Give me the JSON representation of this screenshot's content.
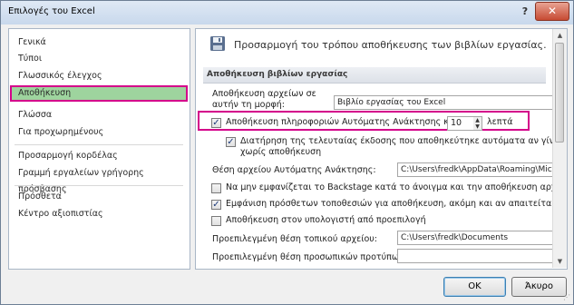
{
  "window": {
    "title": "Επιλογές του Excel",
    "help_glyph": "?",
    "close_glyph": "✕"
  },
  "sidebar": {
    "items": [
      {
        "label": "Γενικά"
      },
      {
        "label": "Τύποι"
      },
      {
        "label": "Γλωσσικός έλεγχος"
      },
      {
        "label": "Αποθήκευση"
      },
      {
        "label": "Γλώσσα"
      },
      {
        "label": "Για προχωρημένους"
      },
      {
        "label": "Προσαρμογή κορδέλας"
      },
      {
        "label": "Γραμμή εργαλείων γρήγορης πρόσβασης"
      },
      {
        "label": "Πρόσθετα"
      },
      {
        "label": "Κέντρο αξιοπιστίας"
      }
    ],
    "selected": "Αποθήκευση"
  },
  "content": {
    "header": "Προσαρμογή του τρόπου αποθήκευσης των βιβλίων εργασίας.",
    "section_title": "Αποθήκευση βιβλίων εργασίας",
    "save_format_label_1": "Αποθήκευση αρχείων σε",
    "save_format_label_2": "αυτήν τη μορφή:",
    "save_format_value": "Βιβλίο εργασίας του Excel",
    "autorecover_label": "Αποθήκευση πληροφοριών Αυτόματης Ανάκτησης κάθε",
    "autorecover_checked": true,
    "autorecover_minutes": "10",
    "minutes_label": "λεπτά",
    "keep_last_label_1": "Διατήρηση της τελευταίας έκδοσης που αποθηκεύτηκε αυτόματα αν γίνει κλείσιμο",
    "keep_last_label_2": "χωρίς αποθήκευση",
    "keep_last_checked": true,
    "autorecover_location_label": "Θέση αρχείου Αυτόματης Ανάκτησης:",
    "autorecover_location_value": "C:\\Users\\fredk\\AppData\\Roaming\\Micro",
    "no_backstage_label": "Να μην εμφανίζεται το Backstage κατά το άνοιγμα και την αποθήκευση αρχείων",
    "no_backstage_checked": false,
    "show_more_places_label": "Εμφάνιση πρόσθετων τοποθεσιών για αποθήκευση, ακόμη και αν απαιτείται είσοδος",
    "show_more_places_checked": true,
    "save_to_computer_label": "Αποθήκευση στον υπολογιστή από προεπιλογή",
    "save_to_computer_checked": false,
    "default_local_label": "Προεπιλεγμένη θέση τοπικού αρχείου:",
    "default_local_value": "C:\\Users\\fredk\\Documents",
    "personal_templates_label": "Προεπιλεγμένη θέση προσωπικών προτύπων:",
    "personal_templates_value": ""
  },
  "buttons": {
    "ok": "OK",
    "cancel": "Άκυρο"
  },
  "colors": {
    "highlight_border": "#d4008a",
    "selected_bg": "#9ed49e"
  }
}
